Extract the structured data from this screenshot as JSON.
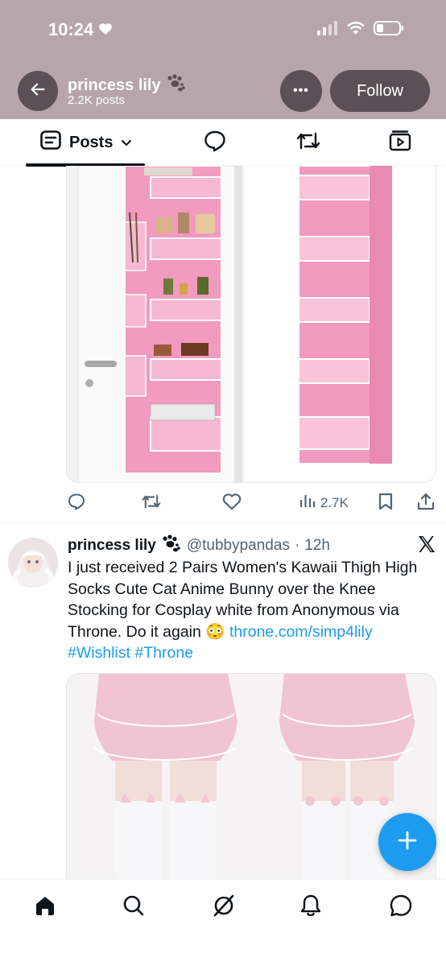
{
  "status": {
    "time": "10:24"
  },
  "header": {
    "name": "princess lily",
    "posts_count": "2.2K posts",
    "follow_label": "Follow",
    "more_label": "•••"
  },
  "tabs": {
    "posts_label": "Posts"
  },
  "post1": {
    "views": "2.7K"
  },
  "post2": {
    "name": "princess lily",
    "handle": "@tubbypandas",
    "separator": "·",
    "time": "12h",
    "text_main": "I just received 2 Pairs Women's Kawaii Thigh High Socks Cute Cat Anime Bunny over the Knee Stocking for Cosplay white from Anonymous via Throne. Do it again",
    "emoji": "😳",
    "link": "throne.com/simp4lily",
    "hashtags": "#Wishlist #Throne"
  },
  "colors": {
    "header_bg": "#b6a6ac",
    "button_bg": "#5b5055",
    "link": "#1d9bf0",
    "organizer_pink": "#f29ac0"
  },
  "icons": [
    "heart-icon",
    "signal-icon",
    "wifi-icon",
    "battery-icon",
    "back-arrow-icon",
    "paw-icon",
    "posts-tab-icon",
    "chevron-down-icon",
    "reply-icon",
    "retweet-icon",
    "video-icon",
    "like-icon",
    "views-icon",
    "bookmark-icon",
    "share-icon",
    "x-logo-icon",
    "plus-icon",
    "home-icon",
    "search-icon",
    "grok-icon",
    "notifications-icon",
    "messages-icon"
  ]
}
